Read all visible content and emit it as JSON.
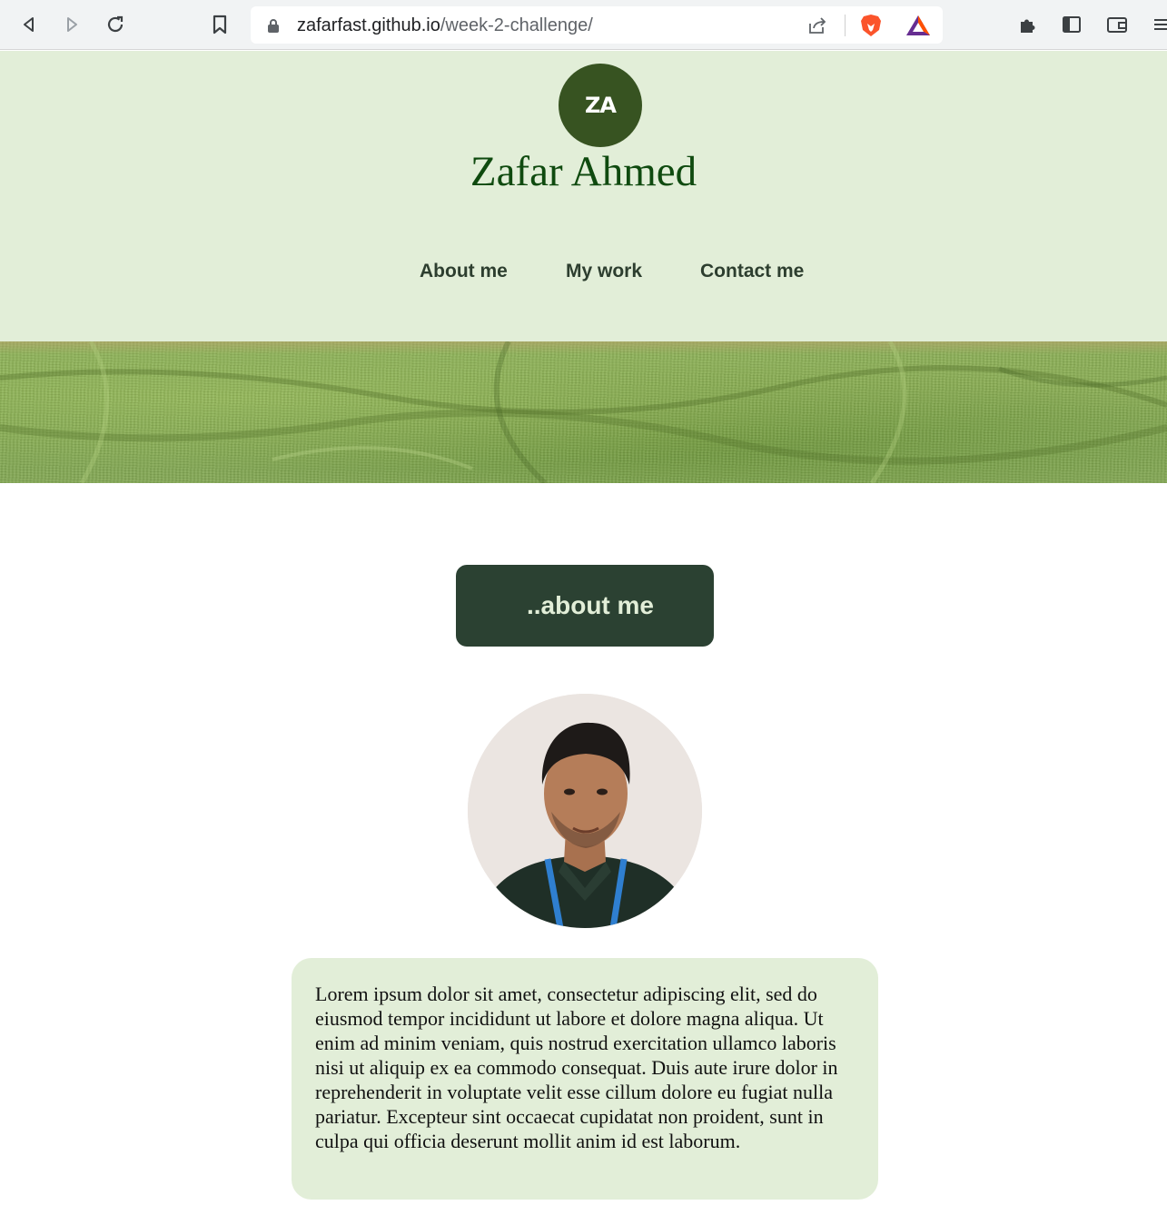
{
  "browser": {
    "url_host": "zafarfast.github.io",
    "url_path": "/week-2-challenge/",
    "icons": [
      "back-icon",
      "forward-icon",
      "reload-icon",
      "bookmark-icon",
      "lock-icon",
      "share-icon",
      "brave-shields-icon",
      "brave-rewards-icon",
      "extensions-icon",
      "sidebar-icon",
      "wallet-icon",
      "menu-icon"
    ]
  },
  "header": {
    "logo_text": "ZA",
    "title": "Zafar Ahmed",
    "nav": [
      {
        "label": "About me"
      },
      {
        "label": "My work"
      },
      {
        "label": "Contact me"
      }
    ]
  },
  "about": {
    "heading": "..about me",
    "paragraph": "Lorem ipsum dolor sit amet, consectetur adipiscing elit, sed do eiusmod tempor incididunt ut labore et dolore magna aliqua. Ut enim ad minim veniam, quis nostrud exercitation ullamco laboris nisi ut aliquip ex ea commodo consequat. Duis aute irure dolor in reprehenderit in voluptate velit esse cillum dolore eu fugiat nulla pariatur. Excepteur sint occaecat cupidatat non proident, sunt in culpa qui officia deserunt mollit anim id est laborum."
  },
  "colors": {
    "header_bg": "#e2eed8",
    "logo_bg": "#375321",
    "title": "#0f4a0f",
    "nav_text": "#2d3e2f",
    "heading_bg": "#2b4132",
    "heading_text": "#e2eed8",
    "card_bg": "#e2eed8"
  }
}
